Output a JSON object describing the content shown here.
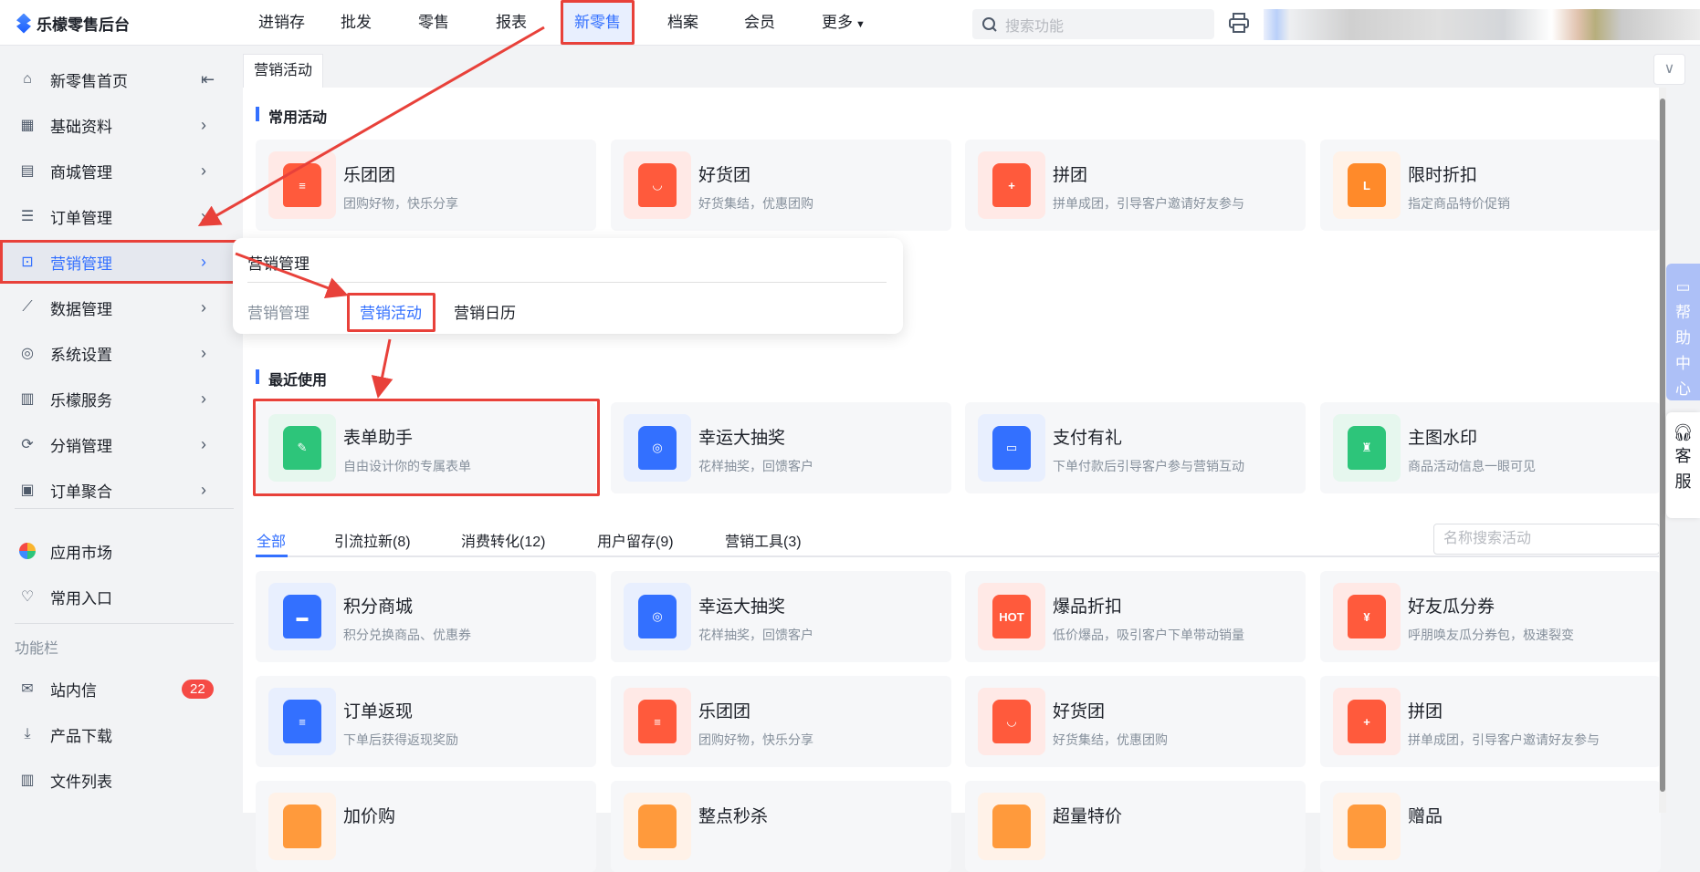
{
  "app": {
    "title": "乐檬零售后台"
  },
  "nav": {
    "items": [
      "进销存",
      "批发",
      "零售",
      "报表",
      "新零售",
      "档案",
      "会员",
      "更多"
    ],
    "active": "新零售"
  },
  "search": {
    "placeholder": "搜索功能"
  },
  "sidebar": {
    "items": [
      {
        "label": "新零售首页",
        "icon": "home-icon"
      },
      {
        "label": "基础资料",
        "icon": "grid-icon"
      },
      {
        "label": "商城管理",
        "icon": "store-icon"
      },
      {
        "label": "订单管理",
        "icon": "order-icon"
      },
      {
        "label": "营销管理",
        "icon": "marketing-icon",
        "active": true
      },
      {
        "label": "数据管理",
        "icon": "chart-icon"
      },
      {
        "label": "系统设置",
        "icon": "settings-icon"
      },
      {
        "label": "乐檬服务",
        "icon": "service-icon"
      },
      {
        "label": "分销管理",
        "icon": "distribution-icon"
      },
      {
        "label": "订单聚合",
        "icon": "aggregate-icon"
      }
    ],
    "extra": [
      {
        "label": "应用市场"
      },
      {
        "label": "常用入口"
      }
    ],
    "section": "功能栏",
    "tools": [
      {
        "label": "站内信",
        "badge": "22"
      },
      {
        "label": "产品下载"
      },
      {
        "label": "文件列表"
      }
    ]
  },
  "page_tab": "营销活动",
  "popup": {
    "title": "营销管理",
    "links": [
      "营销管理",
      "营销活动",
      "营销日历"
    ]
  },
  "common": {
    "title": "常用活动",
    "cards": [
      {
        "title": "乐团团",
        "desc": "团购好物，快乐分享",
        "color": "#ff5a3c",
        "bg": "#ffe9e6",
        "glyph": "≡"
      },
      {
        "title": "好货团",
        "desc": "好货集结，优惠团购",
        "color": "#ff5a3c",
        "bg": "#ffe9e6",
        "glyph": "◡"
      },
      {
        "title": "拼团",
        "desc": "拼单成团，引导客户邀请好友参与",
        "color": "#ff5a3c",
        "bg": "#ffe9e6",
        "glyph": "+"
      },
      {
        "title": "限时折扣",
        "desc": "指定商品特价促销",
        "color": "#ff8a2a",
        "bg": "#fff2e8",
        "glyph": "L"
      }
    ]
  },
  "recent": {
    "title": "最近使用",
    "cards": [
      {
        "title": "表单助手",
        "desc": "自由设计你的专属表单",
        "color": "#2dc57a",
        "bg": "#e6f7ee",
        "glyph": "✎"
      },
      {
        "title": "幸运大抽奖",
        "desc": "花样抽奖，回馈客户",
        "color": "#3370ff",
        "bg": "#e8effe",
        "glyph": "◎"
      },
      {
        "title": "支付有礼",
        "desc": "下单付款后引导客户参与营销互动",
        "color": "#3370ff",
        "bg": "#e8effe",
        "glyph": "▭"
      },
      {
        "title": "主图水印",
        "desc": "商品活动信息一眼可见",
        "color": "#2dc57a",
        "bg": "#e6f7ee",
        "glyph": "♜"
      }
    ]
  },
  "tabs": {
    "items": [
      "全部",
      "引流拉新(8)",
      "消费转化(12)",
      "用户留存(9)",
      "营销工具(3)"
    ],
    "search_placeholder": "名称搜索活动"
  },
  "all": {
    "cards": [
      {
        "title": "积分商城",
        "desc": "积分兑换商品、优惠券",
        "color": "#3370ff",
        "bg": "#e8effe",
        "glyph": "▬"
      },
      {
        "title": "幸运大抽奖",
        "desc": "花样抽奖，回馈客户",
        "color": "#3370ff",
        "bg": "#e8effe",
        "glyph": "◎"
      },
      {
        "title": "爆品折扣",
        "desc": "低价爆品，吸引客户下单带动销量",
        "color": "#ff5a3c",
        "bg": "#ffe9e6",
        "glyph": "HOT"
      },
      {
        "title": "好友瓜分券",
        "desc": "呼朋唤友瓜分券包，极速裂变",
        "color": "#ff5a3c",
        "bg": "#ffe9e6",
        "glyph": "¥"
      },
      {
        "title": "订单返现",
        "desc": "下单后获得返现奖励",
        "color": "#3370ff",
        "bg": "#e8effe",
        "glyph": "≡"
      },
      {
        "title": "乐团团",
        "desc": "团购好物，快乐分享",
        "color": "#ff5a3c",
        "bg": "#ffe9e6",
        "glyph": "≡"
      },
      {
        "title": "好货团",
        "desc": "好货集结，优惠团购",
        "color": "#ff5a3c",
        "bg": "#ffe9e6",
        "glyph": "◡"
      },
      {
        "title": "拼团",
        "desc": "拼单成团，引导客户邀请好友参与",
        "color": "#ff5a3c",
        "bg": "#ffe9e6",
        "glyph": "+"
      },
      {
        "title": "加价购",
        "desc": "",
        "color": "#ff9a3c",
        "bg": "#fff2e8",
        "glyph": ""
      },
      {
        "title": "整点秒杀",
        "desc": "",
        "color": "#ff9a3c",
        "bg": "#fff2e8",
        "glyph": ""
      },
      {
        "title": "超量特价",
        "desc": "",
        "color": "#ff9a3c",
        "bg": "#fff2e8",
        "glyph": ""
      },
      {
        "title": "赠品",
        "desc": "",
        "color": "#ff9a3c",
        "bg": "#fff2e8",
        "glyph": ""
      }
    ]
  },
  "help": {
    "label": "帮助中心",
    "service": "客服"
  }
}
